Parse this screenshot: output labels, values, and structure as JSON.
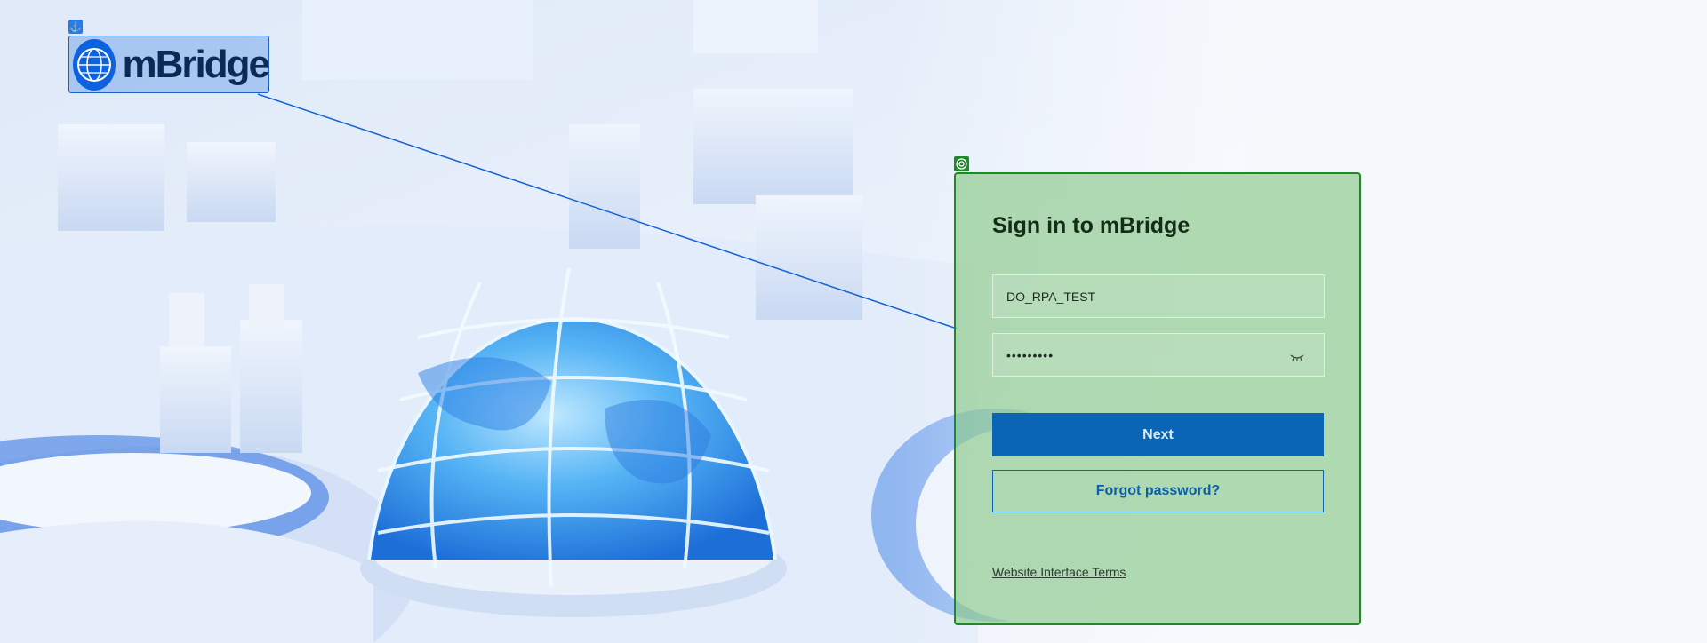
{
  "logo": {
    "text": "mBridge"
  },
  "login": {
    "title": "Sign in to mBridge",
    "username_value": "DO_RPA_TEST",
    "password_value": "•••••••••",
    "next_label": "Next",
    "forgot_label": "Forgot password?",
    "terms_label": "Website Interface Terms"
  },
  "icons": {
    "logo_tag": "anchor-icon",
    "card_tag": "target-icon",
    "password_toggle": "eye-closed-icon",
    "logo_mark": "globe-icon"
  },
  "colors": {
    "primary": "#0a66b4",
    "card_overlay": "#89c889",
    "card_border": "#1e8a26",
    "logo_overlay_border": "#1f5fc4"
  }
}
